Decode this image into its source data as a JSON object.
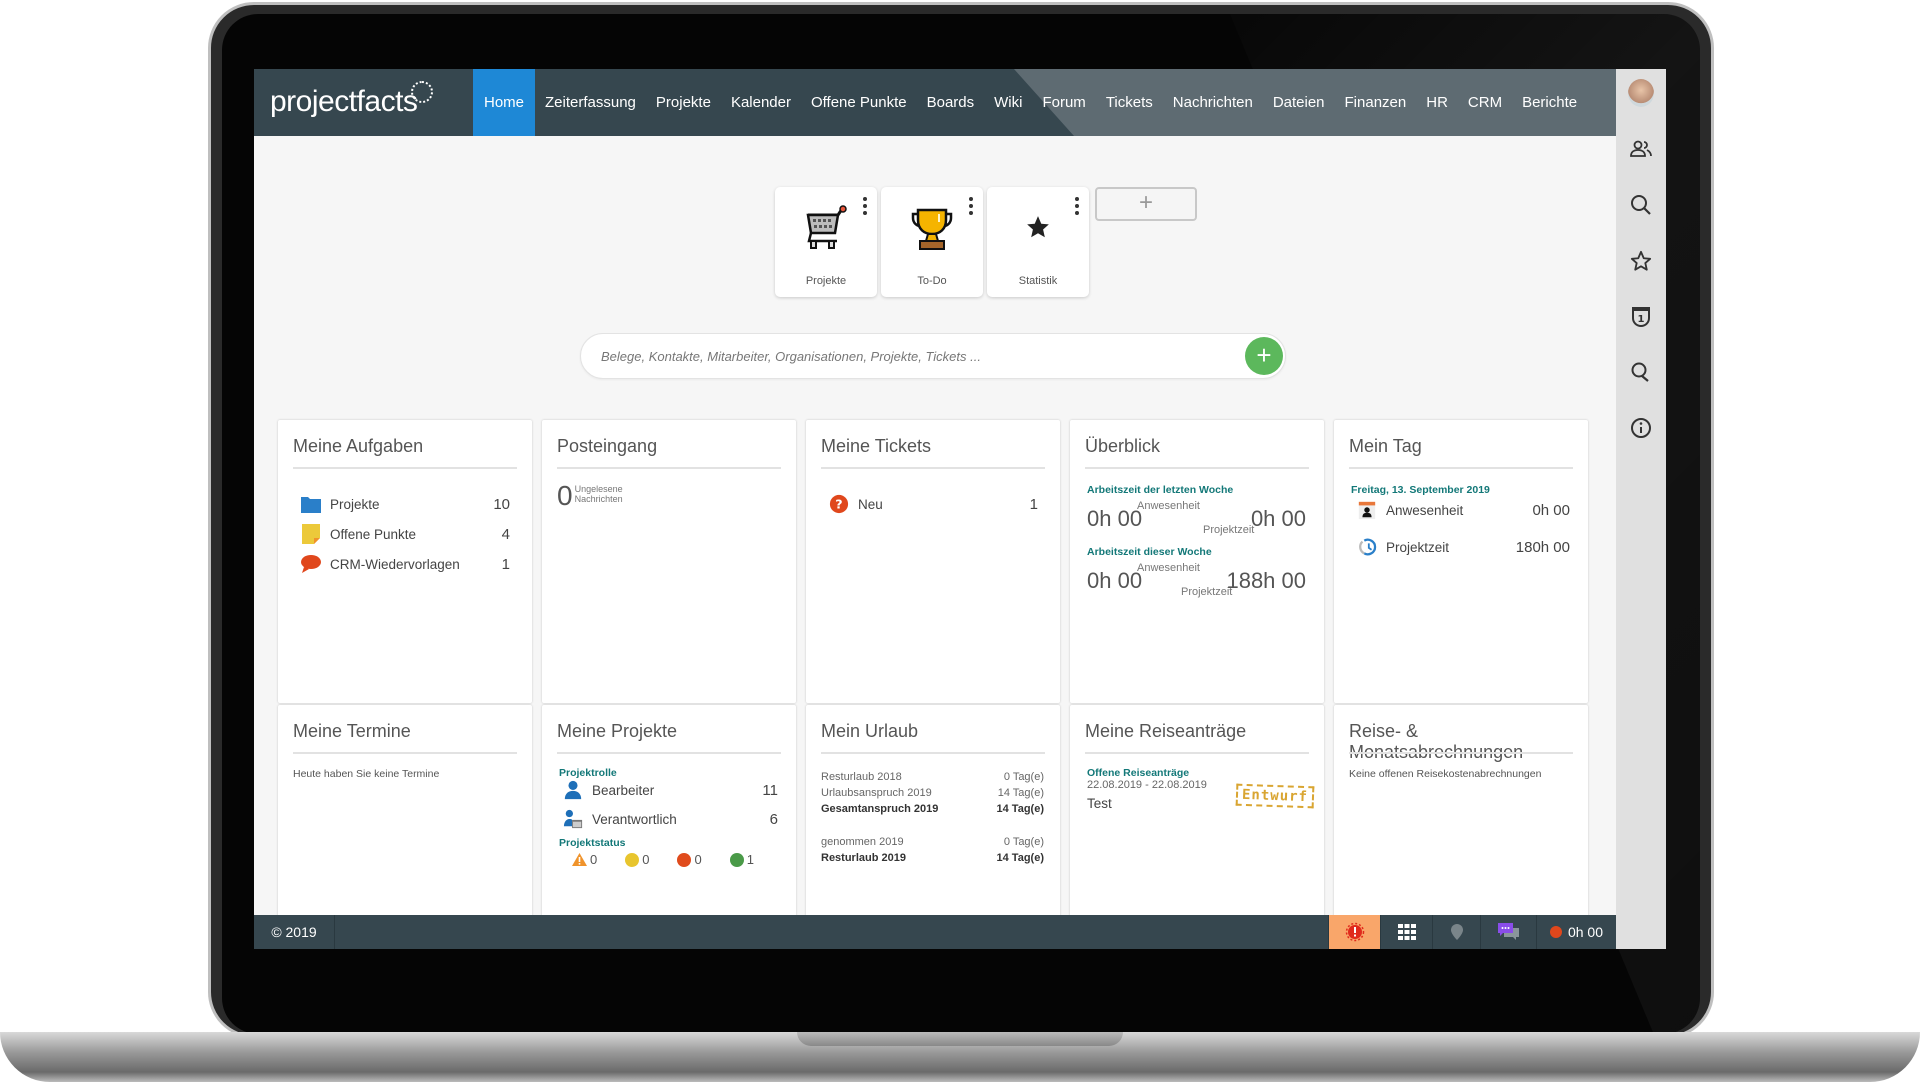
{
  "app": {
    "logo": "projectfacts"
  },
  "nav": {
    "items": [
      {
        "label": "Home",
        "active": true
      },
      {
        "label": "Zeiterfassung"
      },
      {
        "label": "Projekte"
      },
      {
        "label": "Kalender"
      },
      {
        "label": "Offene Punkte"
      },
      {
        "label": "Boards"
      },
      {
        "label": "Wiki"
      },
      {
        "label": "Forum"
      },
      {
        "label": "Tickets"
      },
      {
        "label": "Nachrichten"
      },
      {
        "label": "Dateien"
      },
      {
        "label": "Finanzen"
      },
      {
        "label": "HR"
      },
      {
        "label": "CRM"
      },
      {
        "label": "Berichte"
      }
    ]
  },
  "sidebar_icons": [
    "avatar",
    "users-icon",
    "search-icon",
    "star-icon",
    "badge-icon",
    "location-search-icon",
    "info-icon"
  ],
  "tiles": [
    {
      "label": "Projekte",
      "icon": "shopping-cart-icon"
    },
    {
      "label": "To-Do",
      "icon": "trophy-icon"
    },
    {
      "label": "Statistik",
      "icon": "star-icon"
    }
  ],
  "tile_add_label": "+",
  "search": {
    "placeholder": "Belege, Kontakte, Mitarbeiter, Organisationen, Projekte, Tickets ...",
    "add_label": "+"
  },
  "widgets": {
    "aufgaben": {
      "title": "Meine Aufgaben",
      "rows": [
        {
          "label": "Projekte",
          "value": "10"
        },
        {
          "label": "Offene Punkte",
          "value": "4"
        },
        {
          "label": "CRM-Wiedervorlagen",
          "value": "1"
        }
      ]
    },
    "posteingang": {
      "title": "Posteingang",
      "count": "0",
      "label_1": "Ungelesene",
      "label_2": "Nachrichten"
    },
    "tickets": {
      "title": "Meine Tickets",
      "rows": [
        {
          "label": "Neu",
          "value": "1"
        }
      ]
    },
    "ueberblick": {
      "title": "Überblick",
      "last_week": {
        "heading": "Arbeitszeit der letzten Woche",
        "anwesenheit_label": "Anwesenheit",
        "anwesenheit": "0h 00",
        "projektzeit_label": "Projektzeit",
        "projektzeit": "0h 00"
      },
      "this_week": {
        "heading": "Arbeitszeit dieser Woche",
        "anwesenheit_label": "Anwesenheit",
        "anwesenheit": "0h 00",
        "projektzeit_label": "Projektzeit",
        "projektzeit": "188h 00"
      }
    },
    "meintag": {
      "title": "Mein Tag",
      "date": "Freitag, 13. September 2019",
      "rows": [
        {
          "label": "Anwesenheit",
          "value": "0h 00"
        },
        {
          "label": "Projektzeit",
          "value": "180h 00"
        }
      ]
    },
    "termine": {
      "title": "Meine Termine",
      "empty": "Heute haben Sie keine Termine"
    },
    "projekte": {
      "title": "Meine Projekte",
      "rolle_heading": "Projektrolle",
      "rows": [
        {
          "label": "Bearbeiter",
          "value": "11"
        },
        {
          "label": "Verantwortlich",
          "value": "6"
        }
      ],
      "status_heading": "Projektstatus",
      "status": [
        {
          "type": "warning",
          "color": "#f0932b",
          "value": "0"
        },
        {
          "type": "yellow",
          "color": "#e8c52e",
          "value": "0"
        },
        {
          "type": "red",
          "color": "#e04b1c",
          "value": "0"
        },
        {
          "type": "green",
          "color": "#4a9a48",
          "value": "1"
        }
      ]
    },
    "urlaub": {
      "title": "Mein Urlaub",
      "rows": [
        {
          "label": "Resturlaub 2018",
          "value": "0 Tag(e)",
          "bold": false
        },
        {
          "label": "Urlaubsanspruch 2019",
          "value": "14 Tag(e)",
          "bold": false
        },
        {
          "label": "Gesamtanspruch 2019",
          "value": "14 Tag(e)",
          "bold": true
        },
        {
          "label": "genommen 2019",
          "value": "0 Tag(e)",
          "bold": false
        },
        {
          "label": "Resturlaub 2019",
          "value": "14 Tag(e)",
          "bold": true
        }
      ]
    },
    "reise": {
      "title": "Meine Reiseanträge",
      "heading": "Offene Reiseanträge",
      "dates": "22.08.2019 - 22.08.2019",
      "name": "Test",
      "stamp": "Entwurf"
    },
    "abrechnung": {
      "title": "Reise- & Monatsabrechnungen",
      "empty": "Keine offenen Reisekostenabrechnungen"
    }
  },
  "footer": {
    "copyright": "© 2019",
    "timer": "0h 00"
  },
  "colors": {
    "nav_bg": "#36474f",
    "active": "#1e88d6",
    "teal": "#137878",
    "add_green": "#5cb85c",
    "alert_orange": "#f9a66a"
  }
}
